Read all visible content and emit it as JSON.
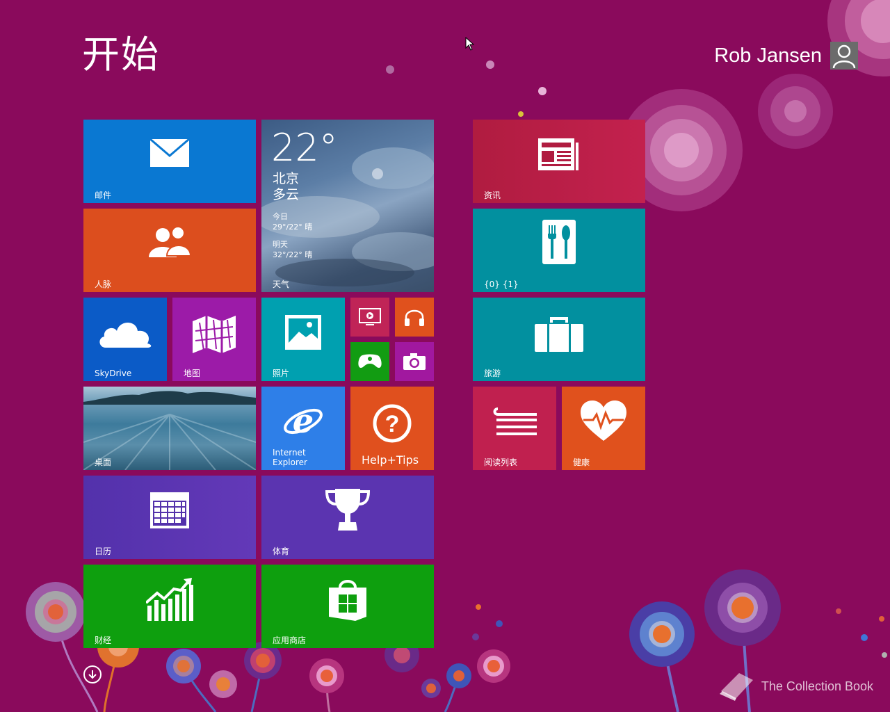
{
  "header": {
    "title": "开始",
    "user_name": "Rob Jansen"
  },
  "tiles": {
    "mail": {
      "label": "邮件",
      "icon": "mail-icon",
      "color": "#0a78d2"
    },
    "weather": {
      "label": "天气",
      "temp": "22°",
      "city": "北京",
      "condition": "多云",
      "today_label": "今日",
      "today_forecast": "29°/22° 晴",
      "tomorrow_label": "明天",
      "tomorrow_forecast": "32°/22° 晴"
    },
    "news": {
      "label": "资讯",
      "icon": "news-icon",
      "color": "#be1e46"
    },
    "people": {
      "label": "人脉",
      "icon": "people-icon",
      "color": "#dc4c1e"
    },
    "food": {
      "label": "{0} {1}",
      "icon": "fork-spoon-icon",
      "color": "#00909f"
    },
    "skydrive": {
      "label": "SkyDrive",
      "icon": "cloud-icon",
      "color": "#0b5bc7"
    },
    "maps": {
      "label": "地图",
      "icon": "map-icon",
      "color": "#9b1ba8"
    },
    "photos": {
      "label": "照片",
      "icon": "photo-icon",
      "color": "#00a0b0"
    },
    "video": {
      "icon": "video-icon",
      "color": "#c02457"
    },
    "music": {
      "icon": "headphones-icon",
      "color": "#e0511d"
    },
    "games": {
      "icon": "xbox-controller-icon",
      "color": "#129c12"
    },
    "camera": {
      "icon": "camera-icon",
      "color": "#a1189f"
    },
    "travel": {
      "label": "旅游",
      "icon": "suitcase-icon",
      "color": "#00909f"
    },
    "desktop": {
      "label": "桌面"
    },
    "ie": {
      "label_line1": "Internet",
      "label_line2": "Explorer",
      "icon": "internet-explorer-icon",
      "color": "#2e7fe8"
    },
    "help": {
      "label": "Help+Tips",
      "icon": "question-icon",
      "color": "#e0501e"
    },
    "reading": {
      "label": "阅读列表",
      "icon": "reading-list-icon",
      "color": "#c0204f"
    },
    "health": {
      "label": "健康",
      "icon": "heart-pulse-icon",
      "color": "#e0511d"
    },
    "calendar": {
      "label": "日历",
      "icon": "calendar-icon",
      "color": "#5b34b0"
    },
    "sports": {
      "label": "体育",
      "icon": "trophy-icon",
      "color": "#5b34b0"
    },
    "finance": {
      "label": "财经",
      "icon": "chart-up-icon",
      "color": "#0e9f0e"
    },
    "store": {
      "label": "应用商店",
      "icon": "store-bag-icon",
      "color": "#0e9f0e"
    }
  },
  "footer": {
    "watermark": "The Collection Book",
    "scroll_icon": "arrow-down-circle-icon"
  }
}
